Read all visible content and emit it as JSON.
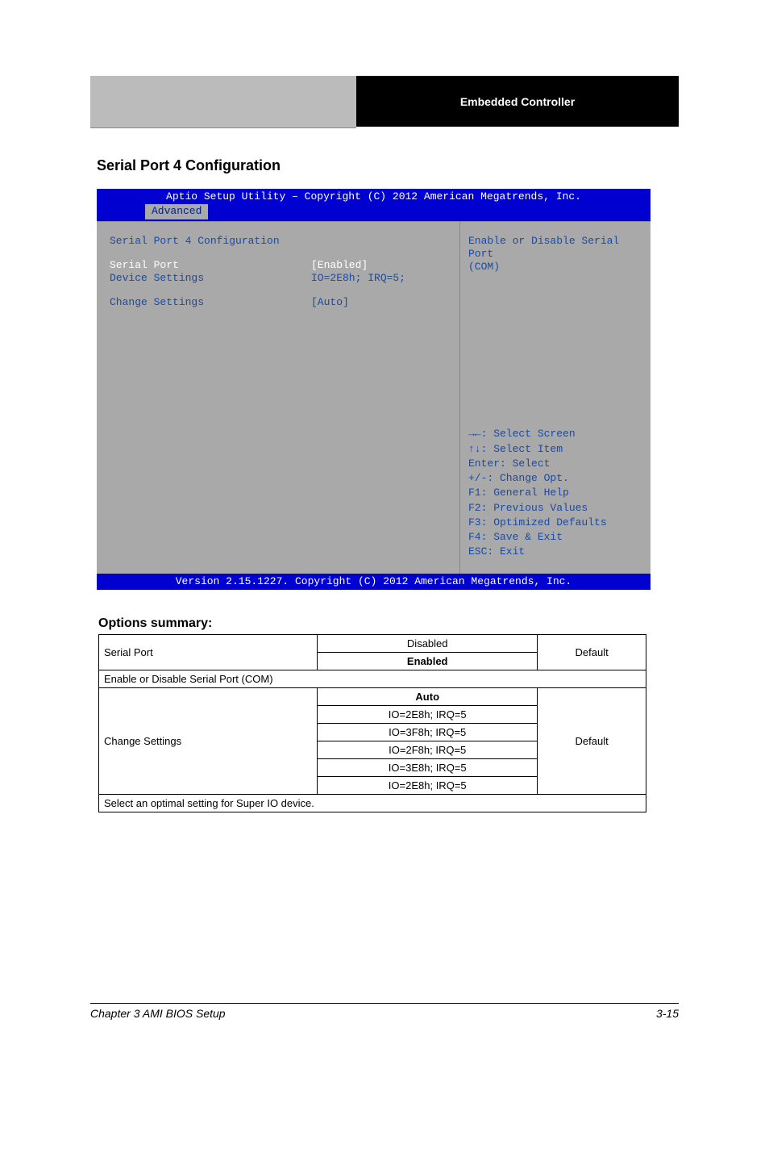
{
  "header": {
    "right_title": "Embedded Controller"
  },
  "section_heading": "Serial Port 4 Configuration",
  "bios": {
    "top_bar": "Aptio Setup Utility – Copyright (C) 2012 American Megatrends, Inc.",
    "tab": "Advanced",
    "title": "Serial Port 4 Configuration",
    "rows": {
      "serial_port": {
        "label": "Serial Port",
        "value": "[Enabled]"
      },
      "device_settings": {
        "label": "Device Settings",
        "value": "IO=2E8h; IRQ=5;"
      },
      "change_settings": {
        "label": "Change Settings",
        "value": "[Auto]"
      }
    },
    "help_text_line1": "Enable or Disable Serial Port",
    "help_text_line2": "(COM)",
    "keys": {
      "k1": "→←: Select Screen",
      "k2": "↑↓: Select Item",
      "k3": "Enter: Select",
      "k4": "+/-: Change Opt.",
      "k5": "F1: General Help",
      "k6": "F2: Previous Values",
      "k7": "F3: Optimized Defaults",
      "k8": "F4: Save & Exit",
      "k9": "ESC: Exit"
    },
    "bottom_bar": "Version 2.15.1227. Copyright (C) 2012 American Megatrends, Inc."
  },
  "options": {
    "heading": "Options summary:",
    "table1": {
      "row_label": "Serial Port",
      "opt1": "Disabled",
      "opt2_label": "Enabled",
      "opt2_flag": "Default",
      "desc": "Enable or Disable Serial Port (COM)"
    },
    "table2": {
      "row_label": "Change Settings",
      "opt1_label": "Auto",
      "opt1_flag": "Default",
      "opt2": "IO=2E8h; IRQ=5",
      "opt3": "IO=3F8h; IRQ=5",
      "opt4": "IO=2F8h; IRQ=5",
      "opt5": "IO=3E8h; IRQ=5",
      "opt6": "IO=2E8h; IRQ=5",
      "desc": "Select an optimal setting for Super IO device."
    }
  },
  "footer": {
    "left": "Chapter 3 AMI BIOS Setup",
    "right": "3-15"
  }
}
